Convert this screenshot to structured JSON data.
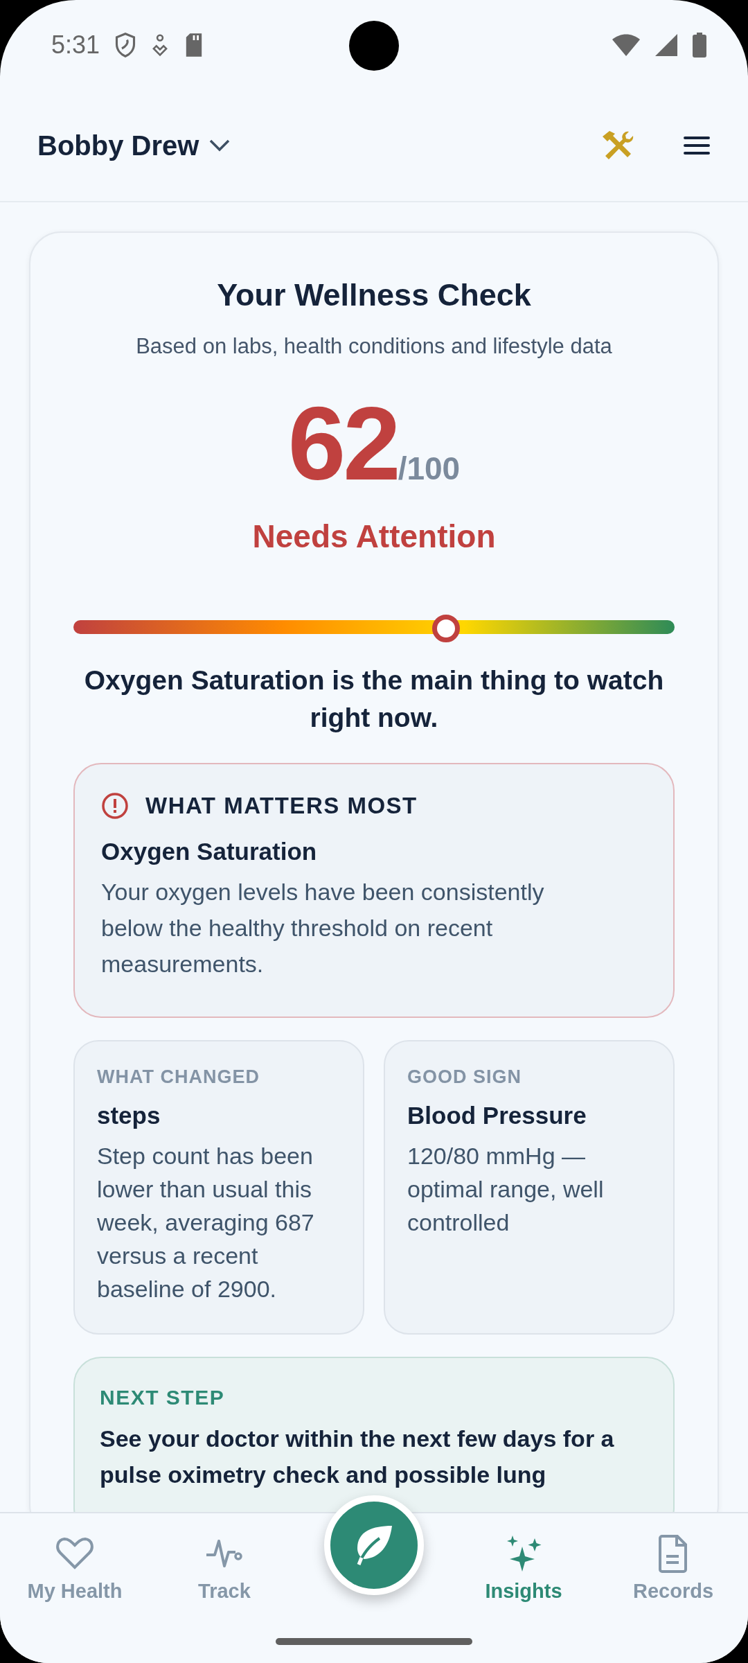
{
  "status_bar": {
    "time": "5:31"
  },
  "header": {
    "profile_name": "Bobby Drew"
  },
  "wellness": {
    "title": "Your Wellness Check",
    "subtitle": "Based on labs, health conditions and lifestyle data",
    "score": "62",
    "score_max": "/100",
    "rating": "Needs Attention",
    "gauge": {
      "level": 0.62
    },
    "summary": "Oxygen Saturation is the main thing to watch right now."
  },
  "alert": {
    "heading": "WHAT MATTERS MOST",
    "title": "Oxygen Saturation",
    "body": "Your oxygen levels have been consistently below the healthy threshold on recent measurements."
  },
  "cards": [
    {
      "label": "WHAT CHANGED",
      "title": "steps",
      "body": "Step count has been lower than usual this week, averaging 687 versus a recent baseline of 2900."
    },
    {
      "label": "GOOD SIGN",
      "title": "Blood Pressure",
      "body": "120/80 mmHg — optimal range, well controlled"
    }
  ],
  "next_step": {
    "label": "NEXT STEP",
    "body": "See your doctor within the next few days for a pulse oximetry check and possible lung"
  },
  "nav": [
    {
      "kind": "heart",
      "label": "My Health",
      "selected": false
    },
    {
      "kind": "pulse",
      "label": "Track",
      "selected": false
    },
    {
      "kind": "sparkles",
      "label": "Insights",
      "selected": true
    },
    {
      "kind": "document",
      "label": "Records",
      "selected": false
    }
  ]
}
